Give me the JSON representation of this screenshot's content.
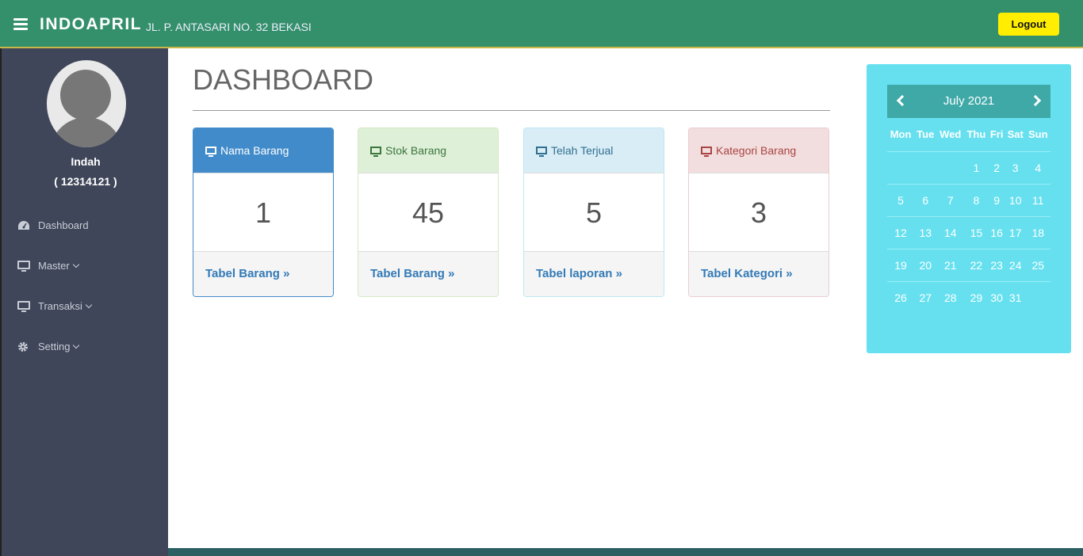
{
  "header": {
    "brand": "INDOAPRIL",
    "address": "JL. P. ANTASARI NO. 32 BEKASI",
    "logout_label": "Logout"
  },
  "user": {
    "name": "Indah",
    "id": "( 12314121 )"
  },
  "sidebar": {
    "items": [
      {
        "label": "Dashboard",
        "icon": "dashboard-icon"
      },
      {
        "label": "Master",
        "icon": "monitor-icon"
      },
      {
        "label": "Transaksi",
        "icon": "monitor-icon"
      },
      {
        "label": "Setting",
        "icon": "gear-icon"
      }
    ]
  },
  "main": {
    "title": "DASHBOARD",
    "panels": [
      {
        "heading": "Nama Barang",
        "value": "1",
        "link": "Tabel Barang »"
      },
      {
        "heading": "Stok Barang",
        "value": "45",
        "link": "Tabel Barang »"
      },
      {
        "heading": "Telah Terjual",
        "value": "5",
        "link": "Tabel laporan »"
      },
      {
        "heading": "Kategori Barang",
        "value": "3",
        "link": "Tabel Kategori »"
      }
    ]
  },
  "calendar": {
    "month_label": "July 2021",
    "weekdays": [
      "Mon",
      "Tue",
      "Wed",
      "Thu",
      "Fri",
      "Sat",
      "Sun"
    ],
    "weeks": [
      [
        "",
        "",
        "",
        "1",
        "2",
        "3",
        "4"
      ],
      [
        "5",
        "6",
        "7",
        "8",
        "9",
        "10",
        "11"
      ],
      [
        "12",
        "13",
        "14",
        "15",
        "16",
        "17",
        "18"
      ],
      [
        "19",
        "20",
        "21",
        "22",
        "23",
        "24",
        "25"
      ],
      [
        "26",
        "27",
        "28",
        "29",
        "30",
        "31",
        ""
      ]
    ]
  },
  "colors": {
    "topbar": "#34906b",
    "sidebar": "#3f4659",
    "logout": "#ffee00",
    "calendar": "#66e0ef"
  }
}
